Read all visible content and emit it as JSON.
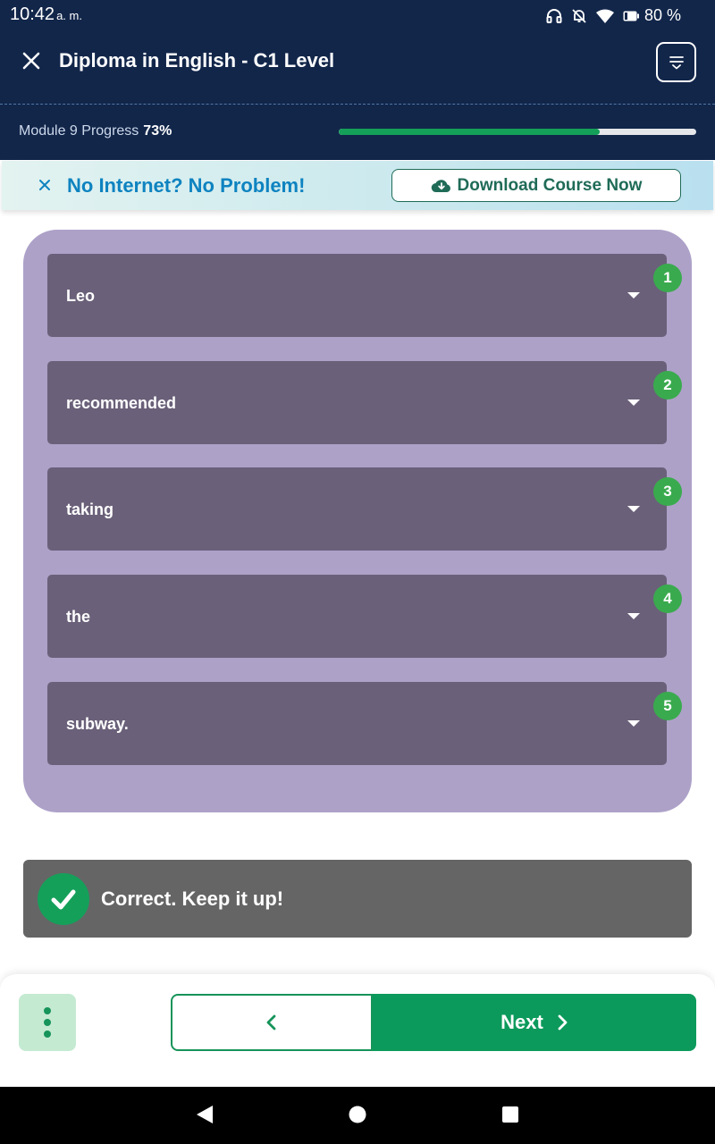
{
  "status_bar": {
    "time": "10:42",
    "ampm": "a. m.",
    "battery": "80 %",
    "icons": [
      "headphones-icon",
      "bell-off-icon",
      "wifi-icon",
      "battery-icon"
    ]
  },
  "header": {
    "title": "Diploma in English - C1 Level",
    "close_icon": "close-icon",
    "menu_icon": "menu-icon"
  },
  "progress": {
    "label": "Module 9 Progress",
    "percent_text": "73%",
    "value": 0.73,
    "fill_color": "#15a05a"
  },
  "banner": {
    "text": "No Internet? No Problem!",
    "download_label": "Download Course Now",
    "text_color": "#0e83c0",
    "button_color": "#1f6b57"
  },
  "question": {
    "card_color": "#ada1c8",
    "slot_color": "#6a6079",
    "badge_color": "#3aaa4e",
    "slots": [
      {
        "number": "1",
        "value": "Leo"
      },
      {
        "number": "2",
        "value": "recommended"
      },
      {
        "number": "3",
        "value": "taking"
      },
      {
        "number": "4",
        "value": "the"
      },
      {
        "number": "5",
        "value": "subway."
      }
    ]
  },
  "feedback": {
    "text": "Correct. Keep it up!",
    "status": "correct",
    "icon": "checkmark-icon"
  },
  "navigation": {
    "next_label": "Next",
    "more_icon": "more-vertical-icon",
    "prev_icon": "chevron-left-icon",
    "next_icon": "chevron-right-icon",
    "accent": "#0b9a5b"
  },
  "system_nav": {
    "buttons": [
      "back-triangle-icon",
      "home-circle-icon",
      "recents-square-icon"
    ]
  }
}
